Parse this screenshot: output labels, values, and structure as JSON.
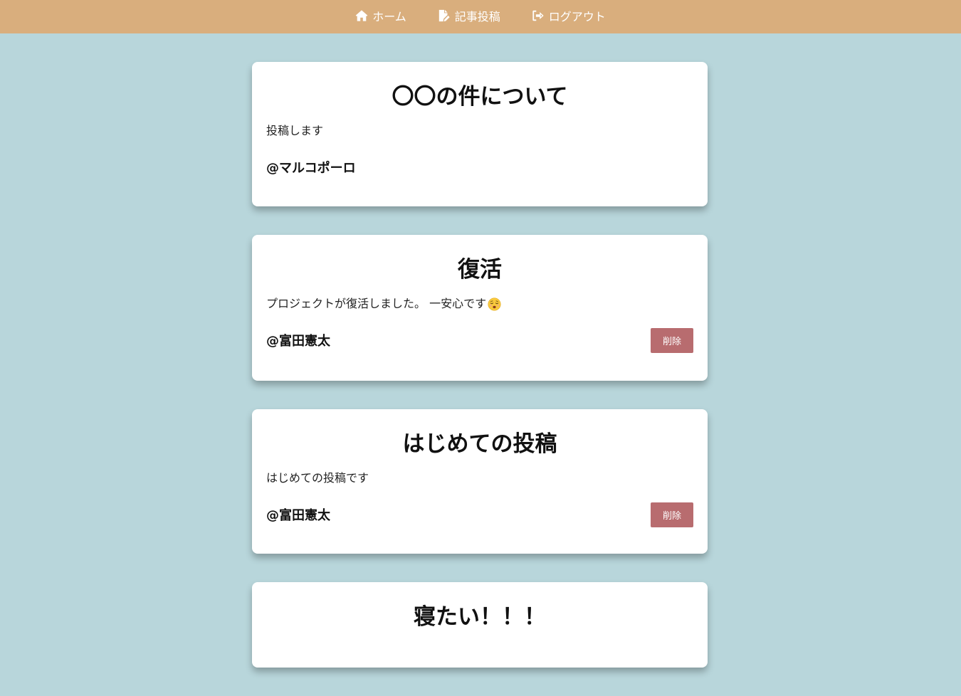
{
  "nav": {
    "home_label": "ホーム",
    "post_label": "記事投稿",
    "logout_label": "ログアウト"
  },
  "colors": {
    "navbar": "#d9ae7d",
    "background": "#b8d6db",
    "delete_button": "#b86c6f"
  },
  "icons": {
    "home": "home-icon",
    "post": "file-pen-icon",
    "logout": "logout-icon",
    "emoji": "relieved-face-emoji"
  },
  "posts": [
    {
      "title": "〇〇の件について",
      "body": "投稿します",
      "author": "@マルコポーロ",
      "delete_label": ""
    },
    {
      "title": "復活",
      "body": "プロジェクトが復活しました。 一安心です",
      "author": "@富田憲太",
      "delete_label": "削除"
    },
    {
      "title": "はじめての投稿",
      "body": "はじめての投稿です",
      "author": "@富田憲太",
      "delete_label": "削除"
    },
    {
      "title": "寝たい！！！"
    }
  ]
}
